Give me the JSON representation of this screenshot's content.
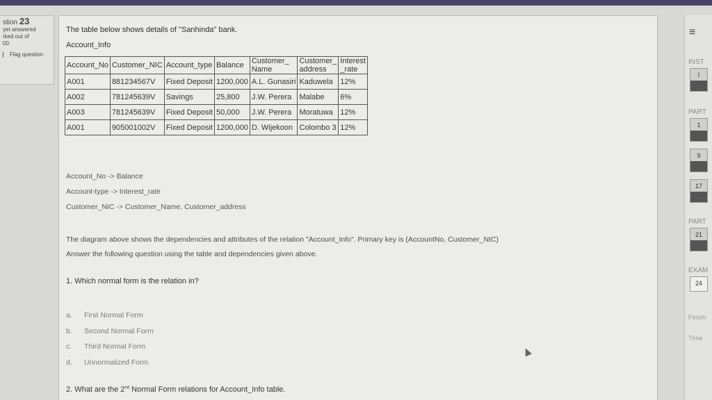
{
  "question_info": {
    "number_prefix": "stion",
    "number": "23",
    "status": "yet answered",
    "marked_out_of": "rked out of",
    "marks": "00",
    "flag_label": "Flag question"
  },
  "intro": "The table below shows details of \"Sanhinda\" bank.",
  "table_name": "Account_Info",
  "table": {
    "headers": [
      [
        "Account_No",
        ""
      ],
      [
        "Customer_NIC",
        ""
      ],
      [
        "Account_type",
        ""
      ],
      [
        "Balance",
        ""
      ],
      [
        "Customer_",
        "Name"
      ],
      [
        "Customer_",
        "address"
      ],
      [
        "Interest",
        "_rate"
      ]
    ],
    "rows": [
      [
        "A001",
        "881234567V",
        "Fixed Deposit",
        "1200,000",
        "A.L. Gunasiri",
        "Kaduwela",
        "12%"
      ],
      [
        "A002",
        "781245639V",
        "Savings",
        "25,800",
        "J.W. Perera",
        "Malabe",
        "6%"
      ],
      [
        "A003",
        "781245639V",
        "Fixed Deposit",
        "50,000",
        "J.W. Perera",
        "Moratuwa",
        "12%"
      ],
      [
        "A001",
        "905001002V",
        "Fixed Deposit",
        "1200,000",
        "D. Wijekoon",
        "Colombo 3",
        "12%"
      ]
    ]
  },
  "dependencies": [
    "Account_No -> Balance",
    "Account-type -> Interest_rate",
    "Customer_NIC -> Customer_Name, Customer_address"
  ],
  "paragraph": [
    "The diagram above shows the dependencies and attributes of the relation \"Account_Info\". Primary key is (AccountNo, Customer_NIC)",
    "Answer the following question using the table and dependencies given above."
  ],
  "question1": "1. Which normal form is the relation in?",
  "options": [
    {
      "letter": "a.",
      "text": "First Normal Form"
    },
    {
      "letter": "b.",
      "text": "Second Normal Form"
    },
    {
      "letter": "c.",
      "text": "Third Normal Form"
    },
    {
      "letter": "d.",
      "text": "Unnormalized Form"
    }
  ],
  "question2": {
    "before": "2. What are the 2",
    "sup": "nd",
    "after": " Normal Form relations for Account_Info table."
  },
  "nav": {
    "menu_icon": "hamburger-icon",
    "inst_label": "INST",
    "inst_box": "I",
    "part1_label": "PART",
    "part1_boxes": [
      "1",
      "9",
      "17"
    ],
    "part2_label": "PART",
    "part2_boxes": [
      "21"
    ],
    "exam_label": "EXAM",
    "exam_box": "24",
    "finish_label": "Finish",
    "time_label": "Time"
  }
}
